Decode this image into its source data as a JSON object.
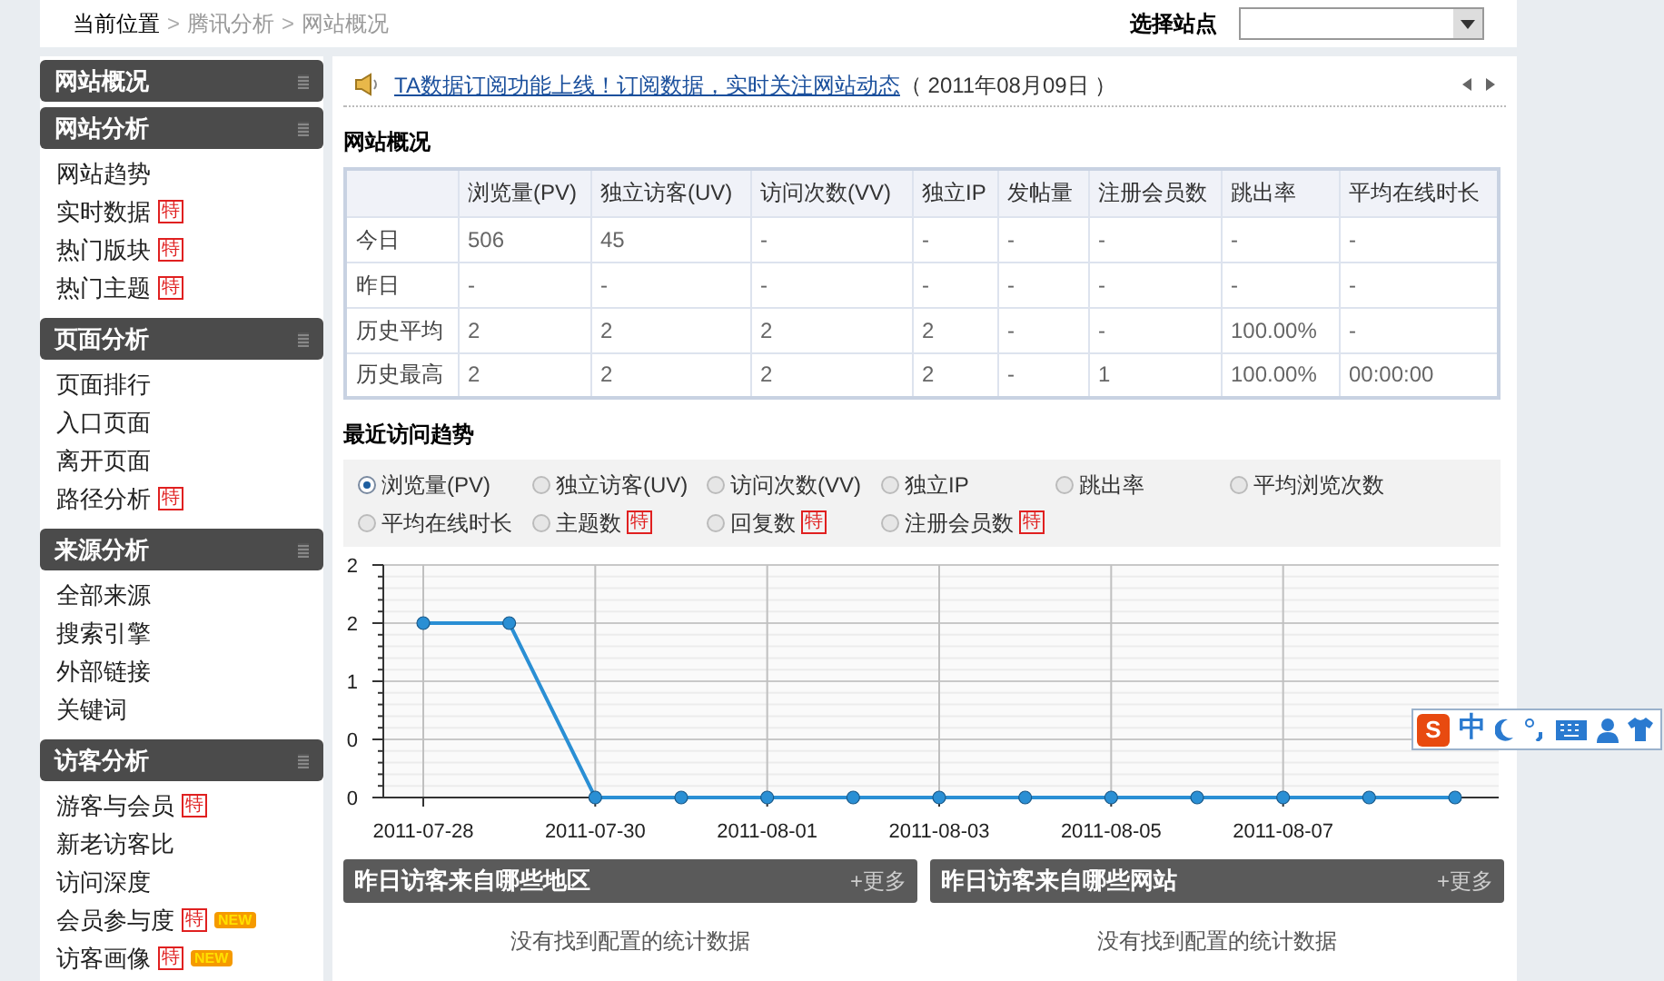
{
  "breadcrumb": {
    "items": [
      "当前位置",
      "腾讯分析",
      "网站概况"
    ],
    "separator": ">"
  },
  "site_selector": {
    "label": "选择站点"
  },
  "sidebar": [
    {
      "title": "网站概况"
    },
    {
      "title": "网站分析",
      "items": [
        {
          "label": "网站趋势"
        },
        {
          "label": "实时数据",
          "badges": [
            {
              "text": "特",
              "kind": "special"
            }
          ]
        },
        {
          "label": "热门版块",
          "badges": [
            {
              "text": "特",
              "kind": "special"
            }
          ]
        },
        {
          "label": "热门主题",
          "badges": [
            {
              "text": "特",
              "kind": "special"
            }
          ]
        }
      ]
    },
    {
      "title": "页面分析",
      "items": [
        {
          "label": "页面排行"
        },
        {
          "label": "入口页面"
        },
        {
          "label": "离开页面"
        },
        {
          "label": "路径分析",
          "badges": [
            {
              "text": "特",
              "kind": "special"
            }
          ]
        }
      ]
    },
    {
      "title": "来源分析",
      "items": [
        {
          "label": "全部来源"
        },
        {
          "label": "搜索引擎"
        },
        {
          "label": "外部链接"
        },
        {
          "label": "关键词"
        }
      ]
    },
    {
      "title": "访客分析",
      "items": [
        {
          "label": "游客与会员",
          "badges": [
            {
              "text": "特",
              "kind": "special"
            }
          ]
        },
        {
          "label": "新老访客比"
        },
        {
          "label": "访问深度"
        },
        {
          "label": "会员参与度",
          "badges": [
            {
              "text": "特",
              "kind": "special"
            },
            {
              "text": "NEW",
              "kind": "new"
            }
          ]
        },
        {
          "label": "访客画像",
          "badges": [
            {
              "text": "特",
              "kind": "special"
            },
            {
              "text": "NEW",
              "kind": "new"
            }
          ]
        }
      ]
    }
  ],
  "notice": {
    "link": "TA数据订阅功能上线！订阅数据，实时关注网站动态",
    "date": "（ 2011年08月09日 ）"
  },
  "overview": {
    "title": "网站概况",
    "columns": [
      "",
      "浏览量(PV)",
      "独立访客(UV)",
      "访问次数(VV)",
      "独立IP",
      "发帖量",
      "注册会员数",
      "跳出率",
      "平均在线时长"
    ],
    "rows": [
      [
        "今日",
        "506",
        "45",
        "-",
        "-",
        "-",
        "-",
        "-",
        "-"
      ],
      [
        "昨日",
        "-",
        "-",
        "-",
        "-",
        "-",
        "-",
        "-",
        "-"
      ],
      [
        "历史平均",
        "2",
        "2",
        "2",
        "2",
        "-",
        "-",
        "100.00%",
        "-"
      ],
      [
        "历史最高",
        "2",
        "2",
        "2",
        "2",
        "-",
        "1",
        "100.00%",
        "00:00:00"
      ]
    ]
  },
  "trend": {
    "title": "最近访问趋势",
    "options": [
      {
        "label": "浏览量(PV)",
        "selected": true
      },
      {
        "label": "独立访客(UV)",
        "selected": false
      },
      {
        "label": "访问次数(VV)",
        "selected": false
      },
      {
        "label": "独立IP",
        "selected": false
      },
      {
        "label": "跳出率",
        "selected": false
      },
      {
        "label": "平均浏览次数",
        "selected": false
      },
      {
        "label": "平均在线时长",
        "selected": false
      },
      {
        "label": "主题数",
        "selected": false,
        "badge": "特"
      },
      {
        "label": "回复数",
        "selected": false,
        "badge": "特"
      },
      {
        "label": "注册会员数",
        "selected": false,
        "badge": "特"
      }
    ],
    "chart_data": {
      "type": "line",
      "categories": [
        "2011-07-28",
        null,
        "2011-07-30",
        null,
        "2011-08-01",
        null,
        "2011-08-03",
        null,
        "2011-08-05",
        null,
        "2011-08-07",
        null,
        null
      ],
      "ylim": [
        0,
        2
      ],
      "grid": true,
      "yticks": [
        {
          "value": 0,
          "label": "0"
        },
        {
          "value": 0.5,
          "label": "0"
        },
        {
          "value": 1,
          "label": "1"
        },
        {
          "value": 1.5,
          "label": "2"
        },
        {
          "value": 2,
          "label": "2"
        }
      ],
      "series": [
        {
          "color": "#2a8fd4",
          "marker": "circle",
          "values": [
            1.5,
            1.5,
            0,
            0,
            0,
            0,
            0,
            0,
            0,
            0,
            0,
            0,
            0
          ]
        }
      ]
    }
  },
  "panels": [
    {
      "title": "昨日访客来自哪些地区",
      "more": "+更多",
      "empty": "没有找到配置的统计数据"
    },
    {
      "title": "昨日访客来自哪些网站",
      "more": "+更多",
      "empty": "没有找到配置的统计数据"
    }
  ],
  "ime_toolbar": {
    "logo": "S",
    "mode": "中"
  }
}
